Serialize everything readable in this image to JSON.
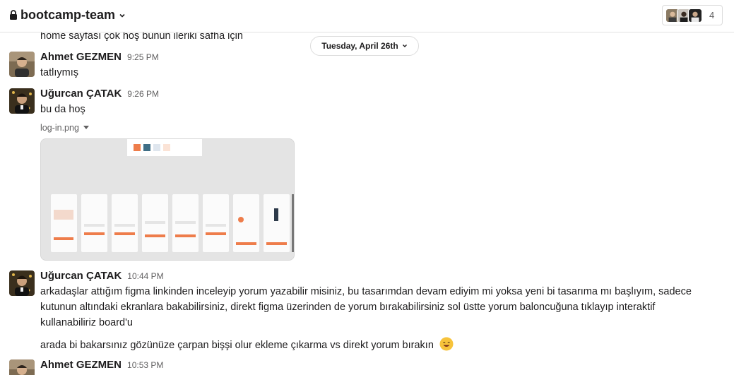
{
  "channel": {
    "name": "bootcamp-team",
    "member_count": "4"
  },
  "date_divider": "Tuesday, April 26th",
  "continuation_text": "home sayfası çok hoş bunun ileriki safha için",
  "messages": [
    {
      "author": "Ahmet GEZMEN",
      "time": "9:25 PM",
      "lines": [
        "tatlıymış"
      ]
    },
    {
      "author": "Uğurcan ÇATAK",
      "time": "9:26 PM",
      "lines": [
        "bu da hoş"
      ],
      "file_name": "log-in.png"
    },
    {
      "author": "Uğurcan ÇATAK",
      "time": "10:44 PM",
      "lines": [
        "arkadaşlar attığım figma linkinden inceleyip yorum yazabilir misiniz, bu tasarımdan devam ediyim mi yoksa yeni bi tasarıma mı başlıyım, sadece",
        "kutunun altındaki ekranlara bakabilirsiniz, direkt figma üzerinden de yorum bırakabilirsiniz sol üstte yorum baloncuğuna tıklayıp interaktif",
        "kullanabiliriz board'u"
      ],
      "extra_line": "arada bi bakarsınız gözünüze çarpan bişşi olur ekleme çıkarma vs direkt yorum bırakın"
    },
    {
      "author": "Ahmet GEZMEN",
      "time": "10:53 PM"
    }
  ],
  "icons": {
    "lock": "lock-icon",
    "channel_chevron": "chevron-down-icon",
    "date_chevron": "chevron-down-icon",
    "file_caret": "caret-down-icon",
    "emoji": "smile-emoji-icon"
  },
  "colors": {
    "accent": "#ee7d4b",
    "text": "#1d1c1d",
    "muted": "#616061",
    "border": "#e2e2e2"
  }
}
